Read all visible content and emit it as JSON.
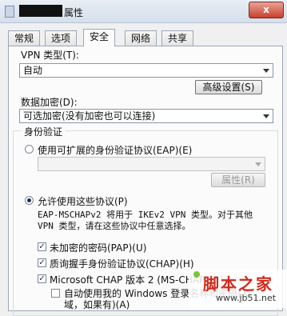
{
  "window": {
    "title_suffix": "属性",
    "close_label": "x"
  },
  "tabs": [
    "常规",
    "选项",
    "安全",
    "网络",
    "共享"
  ],
  "vpn_type": {
    "label": "VPN 类型(T):",
    "value": "自动"
  },
  "advanced_button": "高级设置(S)",
  "encryption": {
    "label": "数据加密(D):",
    "value": "可选加密(没有加密也可以连接)"
  },
  "auth": {
    "title": "身份验证",
    "eap_radio": "使用可扩展的身份验证协议(EAP)(E)",
    "eap_select_value": "",
    "properties_button": "属性(R)",
    "allow_radio": "允许使用这些协议(P)",
    "note_line1": "EAP-MSCHAPv2 将用于 IKEv2 VPN 类型。对于其他",
    "note_line2": "VPN 类型，请在这些协议中任意选择。",
    "protocols": [
      {
        "label": "未加密的密码(PAP)(U)",
        "checked": true
      },
      {
        "label": "质询握手身份验证协议(CHAP)(H)",
        "checked": true
      },
      {
        "label": "Microsoft CHAP 版本 2 (MS-CHAP v2)",
        "checked": true
      }
    ],
    "auto_windows_line1": "自动使用我的 Windows 登录名称和密码(及",
    "auto_windows_line2": "域，如果有)(A)"
  },
  "watermark": {
    "text": "脚本之家",
    "url": "www.jb51.net"
  }
}
